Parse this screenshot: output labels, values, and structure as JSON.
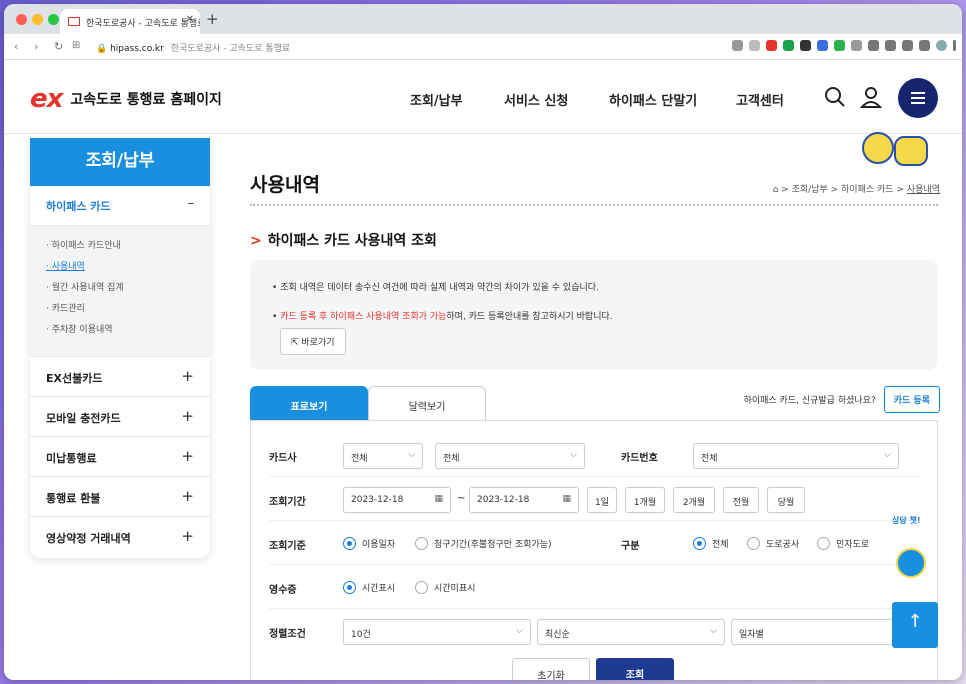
{
  "browser": {
    "tab_title": "한국도로공사 - 고속도로 통행료",
    "url_domain": "hipass.co.kr",
    "url_title": "한국도로공사 - 고속도로 통행료"
  },
  "header": {
    "logo_mark": "ex",
    "logo_text": "고속도로 통행료 홈페이지",
    "nav": [
      "조회/납부",
      "서비스 신청",
      "하이패스 단말기",
      "고객센터"
    ]
  },
  "sidebar": {
    "title": "조회/납부",
    "current_group": "하이패스 카드",
    "current_toggle": "–",
    "sub_items": [
      {
        "label": "· 하이패스 카드안내",
        "active": false
      },
      {
        "label": "· 사용내역",
        "active": true
      },
      {
        "label": "· 월간 사용내역 집계",
        "active": false
      },
      {
        "label": "· 카드관리",
        "active": false
      },
      {
        "label": "· 주차장 이용내역",
        "active": false
      }
    ],
    "groups": [
      "EX선불카드",
      "모바일 충전카드",
      "미납통행료",
      "통행료 환불",
      "영상약정 거래내역"
    ],
    "group_toggle": "+"
  },
  "page": {
    "title": "사용내역",
    "breadcrumb": [
      "조회/납부",
      "하이패스 카드",
      "사용내역"
    ],
    "breadcrumb_sep": ">",
    "section_chevron": ">",
    "section_title": "하이패스 카드 사용내역 조회",
    "notice": {
      "bullet": "•",
      "line1": "조회 내역은 데이터 송수신 여건에 따라 실제 내역과 약간의 차이가 있을 수 있습니다.",
      "line2_red": "카드 등록 후 하이패스 사용내역 조회가 가능",
      "line2_rest": "하며, 카드 등록안내를 참고하시기 바랍니다.",
      "link_label": "바로가기"
    },
    "tabs": [
      {
        "label": "표로보기",
        "active": true
      },
      {
        "label": "달력보기",
        "active": false
      }
    ],
    "register_prompt": "하이패스 카드, 신규발급 하셨나요?",
    "register_button": "카드 등록"
  },
  "form": {
    "card_company": {
      "label": "카드사",
      "value1": "전체",
      "value2": "전체"
    },
    "card_number": {
      "label": "카드번호",
      "value": "전체"
    },
    "period": {
      "label": "조회기간",
      "start": "2023-12-18",
      "separator": "~",
      "end": "2023-12-18",
      "quick": [
        "1일",
        "1개월",
        "2개월",
        "전월",
        "당월"
      ]
    },
    "basis": {
      "label": "조회기준",
      "options": [
        {
          "label": "이용일자",
          "checked": true
        },
        {
          "label": "청구기간(후불청구만 조회가능)",
          "checked": false
        }
      ]
    },
    "category": {
      "label": "구분",
      "options": [
        {
          "label": "전체",
          "checked": true
        },
        {
          "label": "도로공사",
          "checked": false
        },
        {
          "label": "민자도로",
          "checked": false
        }
      ]
    },
    "receipt": {
      "label": "영수증",
      "options": [
        {
          "label": "시간표시",
          "checked": true
        },
        {
          "label": "시간미표시",
          "checked": false
        }
      ]
    },
    "sort": {
      "label": "정렬조건",
      "count": "10건",
      "order": "최신순",
      "group": "일자별"
    },
    "reset_button": "초기화",
    "search_button": "조회"
  },
  "floating": {
    "chat_label": "상담 챗!",
    "top_arrow": "↑"
  },
  "icons": [
    "search-icon",
    "user-icon",
    "menu-icon",
    "home-icon",
    "calendar-icon",
    "link-icon",
    "chevron-down-icon",
    "arrow-up-icon"
  ],
  "colors": {
    "brand_red": "#e4342b",
    "primary_blue": "#1a8fe0",
    "navy": "#16256e",
    "active_blue": "#1a7fd4"
  }
}
